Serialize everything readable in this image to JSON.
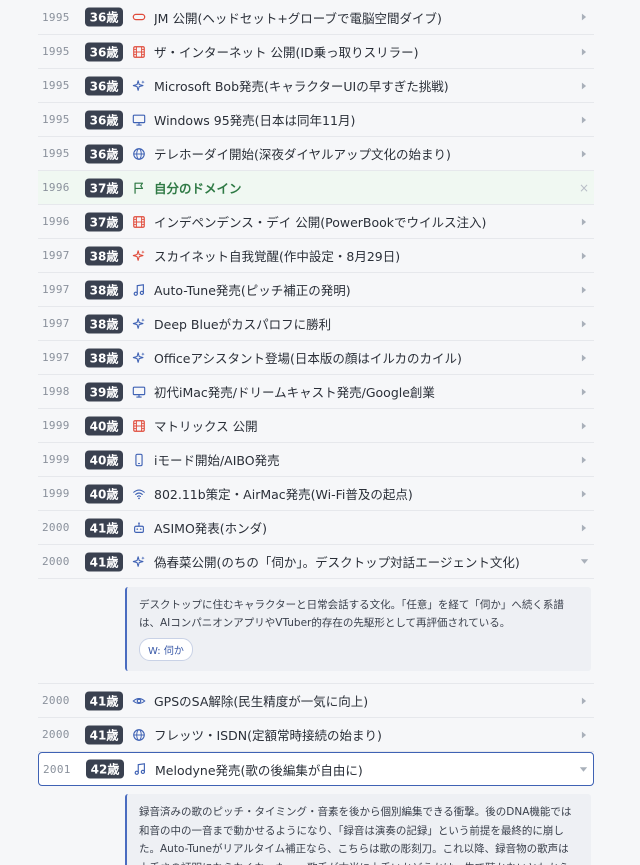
{
  "colors": {
    "icon_red": "#e04a3a",
    "icon_blue": "#3f62b4",
    "icon_green": "#2f7a45",
    "badge_bg": "#3a4150",
    "chevron": "#a9b0ba"
  },
  "rows_top": [
    {
      "year": "1995",
      "age": "36歳",
      "icon": "goggles-icon",
      "title": "JM 公開(ヘッドセット+グローブで電脳空間ダイブ)"
    },
    {
      "year": "1995",
      "age": "36歳",
      "icon": "film-icon",
      "title": "ザ・インターネット 公開(ID乗っ取りスリラー)"
    },
    {
      "year": "1995",
      "age": "36歳",
      "icon": "sparkle-icon",
      "title": "Microsoft Bob発売(キャラクターUIの早すぎた挑戦)"
    },
    {
      "year": "1995",
      "age": "36歳",
      "icon": "monitor-icon",
      "title": "Windows 95発売(日本は同年11月)"
    },
    {
      "year": "1995",
      "age": "36歳",
      "icon": "globe-icon",
      "title": "テレホーダイ開始(深夜ダイヤルアップ文化の始まり)"
    }
  ],
  "highlight_row": {
    "year": "1996",
    "age": "37歳",
    "icon": "flag-icon",
    "title": "自分のドメイン",
    "close": "×"
  },
  "rows_mid": [
    {
      "year": "1996",
      "age": "37歳",
      "icon": "film-icon",
      "title": "インデペンデンス・デイ 公開(PowerBookでウイルス注入)"
    },
    {
      "year": "1997",
      "age": "38歳",
      "icon": "sparkle-icon-red",
      "title": "スカイネット自我覚醒(作中設定・8月29日)"
    },
    {
      "year": "1997",
      "age": "38歳",
      "icon": "music-note-icon",
      "title": "Auto-Tune発売(ピッチ補正の発明)"
    },
    {
      "year": "1997",
      "age": "38歳",
      "icon": "sparkle-icon",
      "title": "Deep Blueがカスパロフに勝利"
    },
    {
      "year": "1997",
      "age": "38歳",
      "icon": "sparkle-icon",
      "title": "Officeアシスタント登場(日本版の顔はイルカのカイル)"
    },
    {
      "year": "1998",
      "age": "39歳",
      "icon": "monitor-icon",
      "title": "初代iMac発売/ドリームキャスト発売/Google創業"
    },
    {
      "year": "1999",
      "age": "40歳",
      "icon": "film-icon",
      "title": "マトリックス 公開"
    },
    {
      "year": "1999",
      "age": "40歳",
      "icon": "phone-icon",
      "title": "iモード開始/AIBO発売"
    },
    {
      "year": "1999",
      "age": "40歳",
      "icon": "wifi-icon",
      "title": "802.11b策定・AirMac発売(Wi-Fi普及の起点)"
    },
    {
      "year": "2000",
      "age": "41歳",
      "icon": "robot-icon",
      "title": "ASIMO発表(ホンダ)"
    }
  ],
  "expanded_row": {
    "year": "2000",
    "age": "41歳",
    "icon": "sparkle-icon",
    "title": "偽春菜公開(のちの「伺か」。デスクトップ対話エージェント文化)",
    "detail": "デスクトップに住むキャラクターと日常会話する文化。「任意」を経て「伺か」へ続く系譜は、AIコンパニオンアプリやVTuber的存在の先駆形として再評価されている。",
    "tag": "W: 伺か"
  },
  "rows_after": [
    {
      "year": "2000",
      "age": "41歳",
      "icon": "eye-icon",
      "title": "GPSのSA解除(民生精度が一気に向上)"
    },
    {
      "year": "2000",
      "age": "41歳",
      "icon": "globe-icon",
      "title": "フレッツ・ISDN(定額常時接続の始まり)"
    }
  ],
  "selected_row": {
    "year": "2001",
    "age": "42歳",
    "icon": "music-note-icon",
    "title": "Melodyne発売(歌の後編集が自由に)",
    "detail": "録音済みの歌のピッチ・タイミング・音素を後から個別編集できる衝撃。後のDNA機能では和音の中の一音まで動かせるようになり、「録音は演奏の記録」という前提を最終的に崩した。Auto-Tuneがリアルタイム補正なら、こちらは歌の彫刻刀。これ以降、録音物の歌声は上手さの証明にならなくなった――歌手が本当に上手いかどうかは、生で聴かないとわからない時代である。"
  }
}
